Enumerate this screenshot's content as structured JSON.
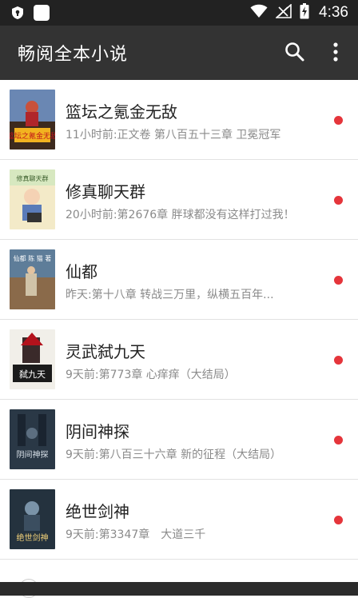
{
  "status_bar": {
    "time": "4:36"
  },
  "app_bar": {
    "title": "畅阅全本小说",
    "search_icon": "search-icon",
    "menu_icon": "more-vert-icon"
  },
  "colors": {
    "status_bar_bg": "#222222",
    "app_bar_bg": "#333333",
    "unread_dot": "#e5353b",
    "title_text": "#222222",
    "sub_text": "#8a8a8a"
  },
  "books": [
    {
      "title": "篮坛之氪金无敌",
      "update": "11小时前:正文卷 第八百五十三章 卫冕冠军",
      "cover_text": "篮坛之氪金无敌",
      "unread": true
    },
    {
      "title": "修真聊天群",
      "update": "20小时前:第2676章 胖球都没有这样打过我！",
      "cover_text": "修真聊天群",
      "unread": true
    },
    {
      "title": "仙都",
      "update": "昨天:第十八章 转战三万里，纵横五百年...",
      "cover_text": "仙都 陈 猫 著",
      "unread": true
    },
    {
      "title": "灵武弑九天",
      "update": "9天前:第773章 心痒痒（大结局）",
      "cover_text": "弑九天",
      "unread": true
    },
    {
      "title": "阴间神探",
      "update": "9天前:第八百三十六章 新的征程（大结局）",
      "cover_text": "阴间神探",
      "unread": true
    },
    {
      "title": "绝世剑神",
      "update": "9天前:第3347章　大道三千",
      "cover_text": "绝世剑神",
      "unread": true
    }
  ]
}
